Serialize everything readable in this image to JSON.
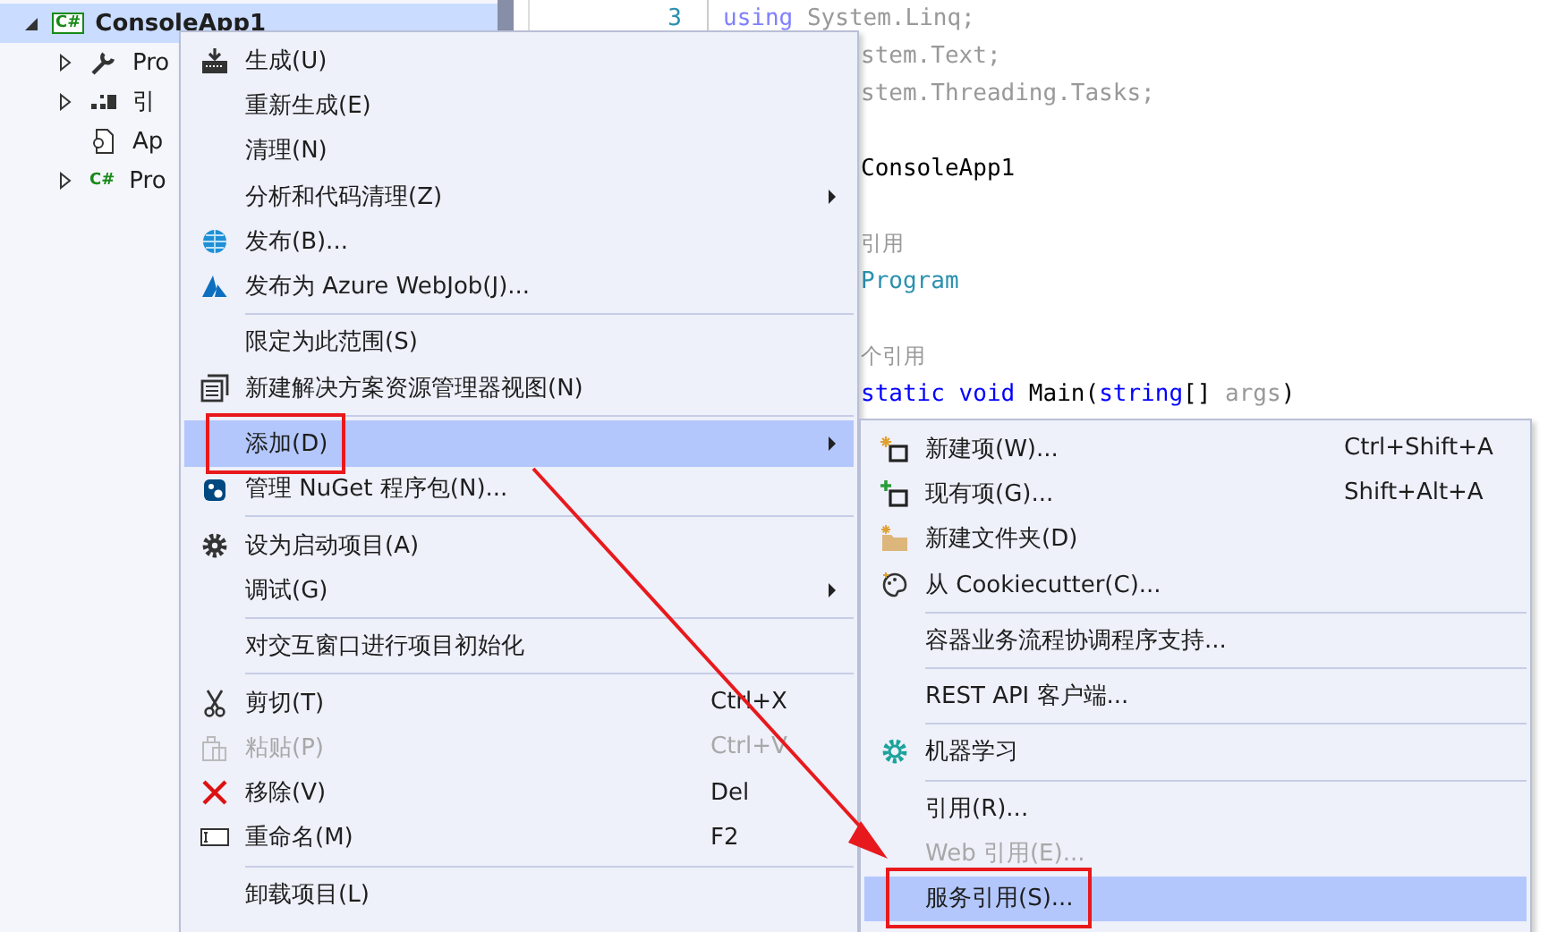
{
  "tree": {
    "project": {
      "label": "ConsoleApp1",
      "icon_text": "C#",
      "selected": true,
      "expanded": true,
      "children": [
        {
          "label": "Pro",
          "expandable": true,
          "expanded": false
        },
        {
          "label": "引",
          "expandable": true,
          "expanded": false
        },
        {
          "label": "Ap",
          "expandable": false
        },
        {
          "label": "Pro",
          "icon_text": "C#",
          "expandable": true,
          "expanded": false
        }
      ]
    }
  },
  "editor": {
    "lines": [
      {
        "number": "3",
        "partial": false,
        "tokens": [
          {
            "text": "using",
            "kind": "keyword_dim"
          },
          {
            "text": " System.Linq;",
            "kind": "dim"
          }
        ]
      },
      {
        "partial": true,
        "tokens": [
          {
            "text": "stem.Text;",
            "kind": "dim"
          }
        ]
      },
      {
        "partial": true,
        "tokens": [
          {
            "text": "stem.Threading.Tasks;",
            "kind": "dim"
          }
        ]
      },
      {
        "kind": "blank"
      },
      {
        "partial": true,
        "tokens": [
          {
            "text": "ConsoleApp1",
            "kind": "plain"
          }
        ]
      },
      {
        "kind": "blank"
      },
      {
        "partial": true,
        "tokens": [
          {
            "text": "引用",
            "kind": "lens"
          }
        ]
      },
      {
        "partial": true,
        "tokens": [
          {
            "text": "Program",
            "kind": "type"
          }
        ]
      },
      {
        "kind": "blank"
      },
      {
        "partial": true,
        "tokens": [
          {
            "text": "个引用",
            "kind": "lens"
          }
        ]
      },
      {
        "partial": true,
        "tokens": [
          {
            "text": "static void",
            "kind": "keyword"
          },
          {
            "text": " Main(",
            "kind": "plain"
          },
          {
            "text": "string",
            "kind": "keyword"
          },
          {
            "text": "[] ",
            "kind": "plain"
          },
          {
            "text": "args",
            "kind": "dim"
          },
          {
            "text": ")",
            "kind": "plain"
          }
        ]
      }
    ]
  },
  "context_menu": {
    "items": [
      {
        "kind": "item",
        "label": "生成(U)",
        "has_submenu": false,
        "disabled": false,
        "selected": false,
        "boxed": false
      },
      {
        "kind": "item",
        "label": "重新生成(E)",
        "has_submenu": false,
        "disabled": false,
        "selected": false,
        "boxed": false
      },
      {
        "kind": "item",
        "label": "清理(N)",
        "has_submenu": false,
        "disabled": false,
        "selected": false,
        "boxed": false
      },
      {
        "kind": "item",
        "label": "分析和代码清理(Z)",
        "has_submenu": true,
        "disabled": false,
        "selected": false,
        "boxed": false
      },
      {
        "kind": "item",
        "label": "发布(B)...",
        "has_submenu": false,
        "disabled": false,
        "selected": false,
        "boxed": false
      },
      {
        "kind": "item",
        "label": "发布为 Azure WebJob(J)...",
        "has_submenu": false,
        "disabled": false,
        "selected": false,
        "boxed": false
      },
      {
        "kind": "separator"
      },
      {
        "kind": "item",
        "label": "限定为此范围(S)",
        "has_submenu": false,
        "disabled": false,
        "selected": false,
        "boxed": false
      },
      {
        "kind": "item",
        "label": "新建解决方案资源管理器视图(N)",
        "has_submenu": false,
        "disabled": false,
        "selected": false,
        "boxed": false
      },
      {
        "kind": "separator"
      },
      {
        "kind": "item",
        "label": "添加(D)",
        "has_submenu": true,
        "disabled": false,
        "selected": true,
        "boxed": true
      },
      {
        "kind": "item",
        "label": "管理 NuGet 程序包(N)...",
        "has_submenu": false,
        "disabled": false,
        "selected": false,
        "boxed": false
      },
      {
        "kind": "separator"
      },
      {
        "kind": "item",
        "label": "设为启动项目(A)",
        "has_submenu": false,
        "disabled": false,
        "selected": false,
        "boxed": false
      },
      {
        "kind": "item",
        "label": "调试(G)",
        "has_submenu": true,
        "disabled": false,
        "selected": false,
        "boxed": false
      },
      {
        "kind": "separator"
      },
      {
        "kind": "item",
        "label": "对交互窗口进行项目初始化",
        "has_submenu": false,
        "disabled": false,
        "selected": false,
        "boxed": false
      },
      {
        "kind": "separator"
      },
      {
        "kind": "item",
        "label": "剪切(T)",
        "shortcut": "Ctrl+X",
        "has_submenu": false,
        "disabled": false,
        "selected": false,
        "boxed": false
      },
      {
        "kind": "item",
        "label": "粘贴(P)",
        "shortcut": "Ctrl+V",
        "has_submenu": false,
        "disabled": true,
        "selected": false,
        "boxed": false
      },
      {
        "kind": "item",
        "label": "移除(V)",
        "shortcut": "Del",
        "has_submenu": false,
        "disabled": false,
        "selected": false,
        "boxed": false
      },
      {
        "kind": "item",
        "label": "重命名(M)",
        "shortcut": "F2",
        "has_submenu": false,
        "disabled": false,
        "selected": false,
        "boxed": false
      },
      {
        "kind": "separator"
      },
      {
        "kind": "item",
        "label": "卸载项目(L)",
        "has_submenu": false,
        "disabled": false,
        "selected": false,
        "boxed": false
      }
    ]
  },
  "add_submenu": {
    "items": [
      {
        "kind": "item",
        "label": "新建项(W)...",
        "shortcut": "Ctrl+Shift+A",
        "disabled": false,
        "selected": false,
        "boxed": false
      },
      {
        "kind": "item",
        "label": "现有项(G)...",
        "shortcut": "Shift+Alt+A",
        "disabled": false,
        "selected": false,
        "boxed": false
      },
      {
        "kind": "item",
        "label": "新建文件夹(D)",
        "disabled": false,
        "selected": false,
        "boxed": false
      },
      {
        "kind": "item",
        "label": "从 Cookiecutter(C)...",
        "disabled": false,
        "selected": false,
        "boxed": false
      },
      {
        "kind": "separator"
      },
      {
        "kind": "item",
        "label": "容器业务流程协调程序支持...",
        "disabled": false,
        "selected": false,
        "boxed": false
      },
      {
        "kind": "separator"
      },
      {
        "kind": "item",
        "label": "REST API 客户端...",
        "disabled": false,
        "selected": false,
        "boxed": false
      },
      {
        "kind": "separator"
      },
      {
        "kind": "item",
        "label": "机器学习",
        "disabled": false,
        "selected": false,
        "boxed": false
      },
      {
        "kind": "separator"
      },
      {
        "kind": "item",
        "label": "引用(R)...",
        "disabled": false,
        "selected": false,
        "boxed": false
      },
      {
        "kind": "item",
        "label": "Web 引用(E)...",
        "disabled": true,
        "selected": false,
        "boxed": false
      },
      {
        "kind": "item",
        "label": "服务引用(S)...",
        "disabled": false,
        "selected": true,
        "boxed": true
      }
    ]
  }
}
